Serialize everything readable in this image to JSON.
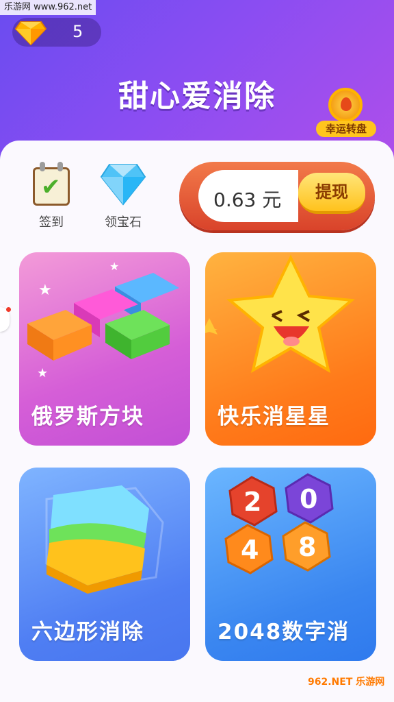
{
  "watermark_top": "乐游网 www.962.net",
  "header": {
    "gem_count": "5",
    "title": "甜心爱消除",
    "lucky_wheel_label": "幸运转盘"
  },
  "actions": {
    "checkin_label": "签到",
    "diamond_label": "领宝石",
    "cash_amount": "0.63 元",
    "withdraw_label": "提现"
  },
  "games": [
    {
      "title": "俄罗斯方块"
    },
    {
      "title": "快乐消星星"
    },
    {
      "title": "六边形消除"
    },
    {
      "title": "2048数字消",
      "tiles": [
        "2",
        "0",
        "4",
        "8"
      ]
    }
  ],
  "watermark_bottom": "962.NET 乐游网"
}
